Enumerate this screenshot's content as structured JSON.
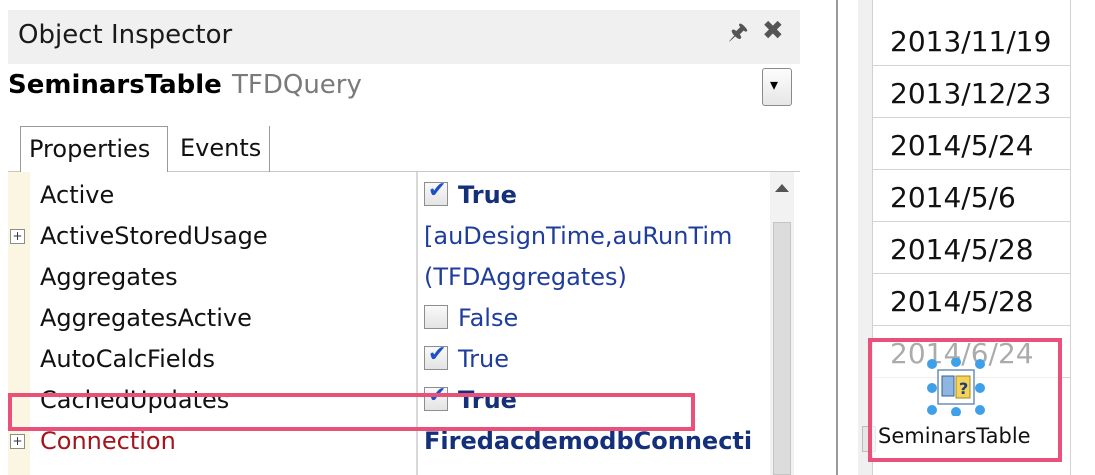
{
  "inspector": {
    "title": "Object Inspector",
    "component_name": "SeminarsTable",
    "component_type": "TFDQuery",
    "tabs": [
      "Properties",
      "Events"
    ],
    "properties": [
      {
        "name": "Active",
        "value": "True",
        "checkbox": true,
        "checked": true,
        "expandable": false,
        "style": "bold"
      },
      {
        "name": "ActiveStoredUsage",
        "value": "[auDesignTime,auRunTim",
        "checkbox": false,
        "expandable": true,
        "style": "blue"
      },
      {
        "name": "Aggregates",
        "value": "(TFDAggregates)",
        "checkbox": false,
        "expandable": false,
        "style": "blue"
      },
      {
        "name": "AggregatesActive",
        "value": "False",
        "checkbox": true,
        "checked": false,
        "expandable": false,
        "style": "blue"
      },
      {
        "name": "AutoCalcFields",
        "value": "True",
        "checkbox": true,
        "checked": true,
        "expandable": false,
        "style": "blue"
      },
      {
        "name": "CachedUpdates",
        "value": "True",
        "checkbox": true,
        "checked": true,
        "expandable": false,
        "style": "bold"
      },
      {
        "name": "Connection",
        "value": "FiredacdemodbConnecti",
        "checkbox": false,
        "expandable": true,
        "style": "bold",
        "name_color": "red"
      }
    ],
    "highlight_color": "#e8527a"
  },
  "form": {
    "dates": [
      "2013/11/19",
      "2013/12/23",
      "2014/5/24",
      "2014/5/6",
      "2014/5/28",
      "2014/5/28",
      "2014/6/24"
    ],
    "component_label": "SeminarsTable"
  },
  "icons": {
    "pin": "pin-icon",
    "close": "close-icon",
    "dropdown": "chevron-down-icon",
    "expand": "expand-plus-icon",
    "check": "checkmark-icon",
    "component": "query-component-icon"
  }
}
